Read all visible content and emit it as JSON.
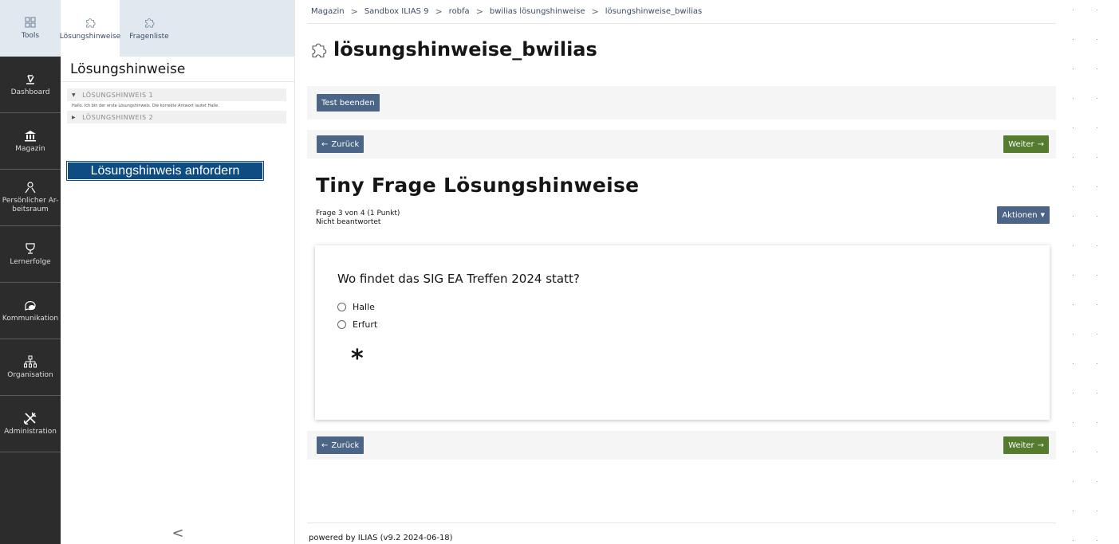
{
  "mainbar": {
    "items": [
      {
        "label": "Tools",
        "icon": "grid-icon"
      },
      {
        "label": "Dashboard",
        "icon": "dashboard-icon"
      },
      {
        "label": "Magazin",
        "icon": "bank-icon"
      },
      {
        "label": "Persönlicher Ar-beitsraum",
        "icon": "person-icon"
      },
      {
        "label": "Lernerfolge",
        "icon": "trophy-icon"
      },
      {
        "label": "Kommunikation",
        "icon": "chat-icon"
      },
      {
        "label": "Organisation",
        "icon": "org-icon"
      },
      {
        "label": "Administration",
        "icon": "tools-icon"
      }
    ]
  },
  "slate": {
    "tabs": [
      {
        "label": "Lösungshinweise",
        "icon": "puzzle-icon"
      },
      {
        "label": "Fragenliste",
        "icon": "puzzle-icon"
      }
    ],
    "title": "Lösungshinweise",
    "hints": [
      {
        "label": "LÖSUNGSHINWEIS 1",
        "text": "Hallo. Ich bin der erste Lösungshinweis. Die korrekte Antwort lautet Halle."
      },
      {
        "label": "LÖSUNGSHINWEIS 2"
      }
    ],
    "request_button": "Lösungshinweis anfordern",
    "collapse": "<"
  },
  "breadcrumb": [
    "Magazin",
    "Sandbox ILIAS 9",
    "robfa",
    "bwilias lösungshinweise",
    "lösungshinweise_bwilias"
  ],
  "page_title": "lösungshinweise_bwilias",
  "toolbar": {
    "end_test": "Test beenden"
  },
  "nav": {
    "back": "Zurück",
    "next": "Weiter"
  },
  "question": {
    "title": "Tiny Frage Lösungshinweise",
    "meta_line1": "Frage 3 von 4 (1 Punkt)",
    "meta_line2": "Nicht beantwortet",
    "actions": "Aktionen",
    "text": "Wo findet das SIG EA Treffen 2024 statt?",
    "answers": [
      "Halle",
      "Erfurt"
    ],
    "marker": "*"
  },
  "footer": "powered by ILIAS (v9.2 2024-06-18)",
  "colors": {
    "mainbar": "#2c2c2c",
    "primary": "#4c6586",
    "next": "#557b2e",
    "request": "#0f4c81"
  }
}
